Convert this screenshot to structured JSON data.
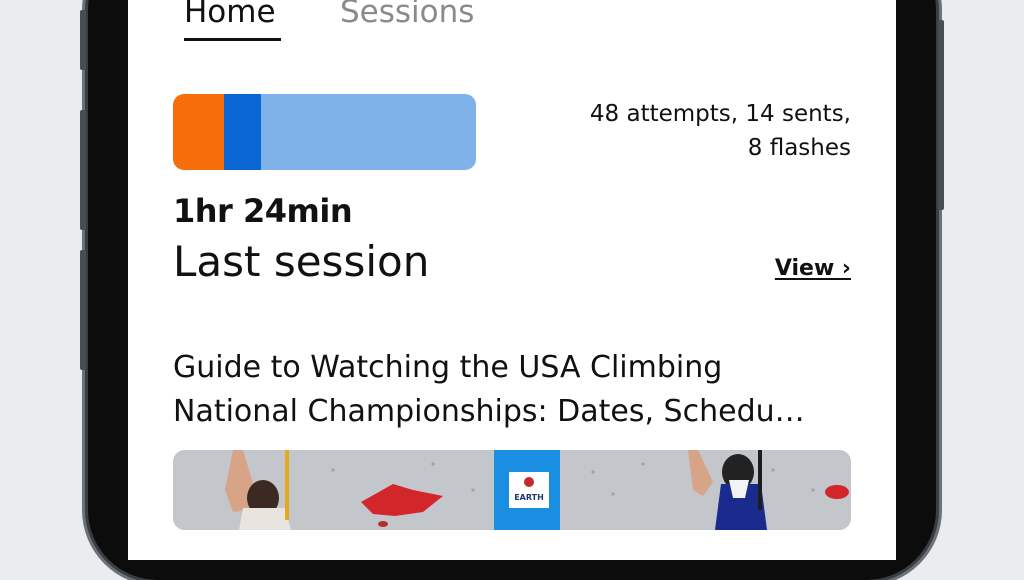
{
  "tabs": [
    {
      "label": "Home",
      "active": true
    },
    {
      "label": "Sessions",
      "active": false
    }
  ],
  "session": {
    "bar_segments": [
      {
        "color": "#f76d0b",
        "fraction": 0.167
      },
      {
        "color": "#0a66d3",
        "fraction": 0.122
      },
      {
        "color": "#7fb2e8",
        "fraction": 0.711
      }
    ],
    "stats_line1": "48 attempts, 14 sents,",
    "stats_line2": "8 flashes",
    "duration": "1hr 24min",
    "label": "Last session",
    "view_label": "View ›"
  },
  "article": {
    "title_line1": "Guide to Watching the USA Climbing",
    "title_line2": "National Championships: Dates, Schedu…",
    "image_badge": "EARTH"
  }
}
